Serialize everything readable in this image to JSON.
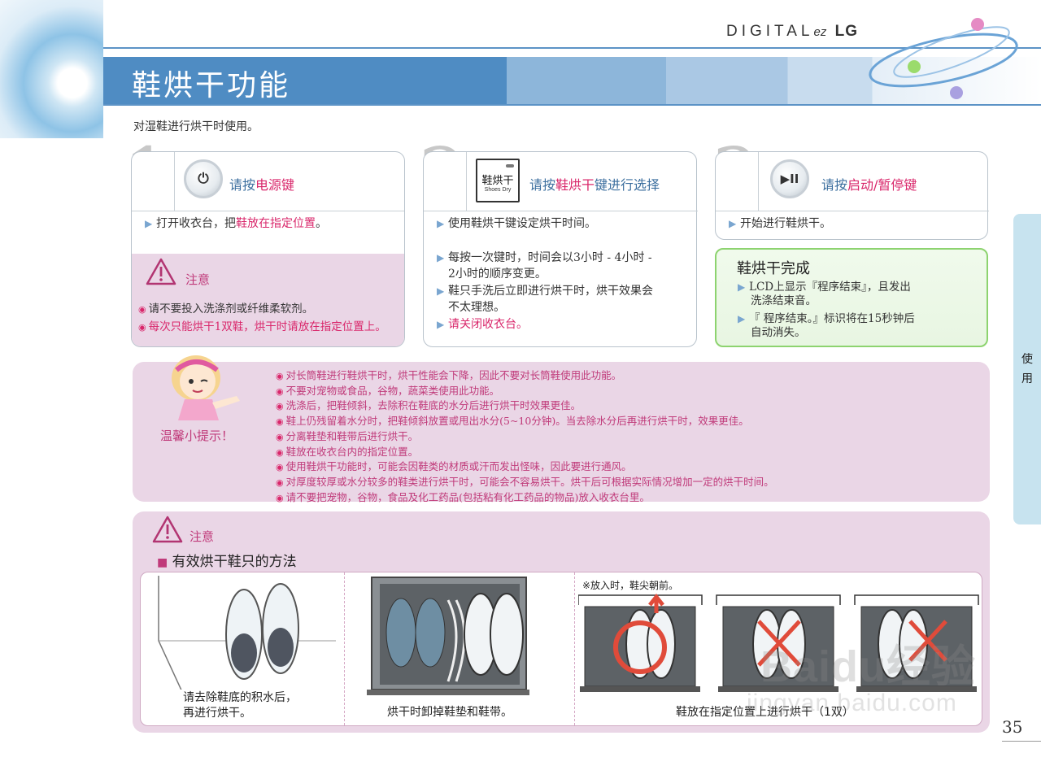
{
  "header": {
    "page_title": "鞋烘干功能",
    "brand_main": "DIGITAL",
    "brand_ez": "ez",
    "brand_lg": "LG"
  },
  "intro": "对湿鞋进行烘干时使用。",
  "step1": {
    "num": "1",
    "btn_glyph": "⏻",
    "head_pre": "请按",
    "head_hl": "电源键",
    "item_pre": "打开收衣台，把",
    "item_hl": "鞋放在指定位置",
    "item_post": "。",
    "caution_title": "注意",
    "caution_items": [
      "请不要投入洗涤剂或纤维柔软剂。",
      "每次只能烘干1双鞋，烘干时请放在指定位置上。"
    ]
  },
  "step2": {
    "num": "2",
    "btn_label_cn": "鞋烘干",
    "btn_label_en": "Shoes Dry",
    "head_pre": "请按",
    "head_hl": "鞋烘干",
    "head_post": "键进行选择",
    "items": [
      "使用鞋烘干键设定烘干时间。",
      "每按一次键时，时间会以3小时 - 4小时 -",
      "2小时的顺序变更。",
      "鞋只手洗后立即进行烘干时，烘干效果会",
      "不太理想。",
      "请关闭收衣台。"
    ]
  },
  "step3": {
    "num": "3",
    "btn_glyph": "▶II",
    "head_pre": "请按",
    "head_hl": "启动/暂停键",
    "item": "开始进行鞋烘干。"
  },
  "done": {
    "title": "鞋烘干完成",
    "items": [
      "LCD上显示『程序结束』，且发出",
      "洗涤结束音。",
      "『 程序结束。』标识将在15秒钟后",
      "自动消失。"
    ]
  },
  "tips": {
    "label": "温馨小提示！",
    "items": [
      "对长筒鞋进行鞋烘干时，烘干性能会下降，因此不要对长筒鞋使用此功能。",
      "不要对宠物或食品，谷物，蔬菜类使用此功能。",
      "洗涤后，把鞋倾斜，去除积在鞋底的水分后进行烘干时效果更佳。",
      "鞋上仍残留着水分时，把鞋倾斜放置或甩出水分(5~10分钟)。当去除水分后再进行烘干时，效果更佳。",
      "分离鞋垫和鞋带后进行烘干。",
      "鞋放在收衣台内的指定位置。",
      "使用鞋烘干功能时，可能会因鞋类的材质或汗而发出怪味，因此要进行通风。",
      "对厚度较厚或水分较多的鞋类进行烘干时，可能会不容易烘干。烘干后可根据实际情况增加一定的烘干时间。",
      "请不要把宠物，谷物，食品及化工药品(包括粘有化工药品的物品)放入收衣台里。"
    ]
  },
  "caution2": {
    "title": "注意",
    "subtitle": "有效烘干鞋只的方法",
    "note": "※放入时，鞋尖朝前。",
    "caption1_line1": "请去除鞋底的积水后，",
    "caption1_line2": "再进行烘干。",
    "caption2": "烘干时卸掉鞋垫和鞋带。",
    "caption3": "鞋放在指定位置上进行烘干（1双）"
  },
  "side_tab": "使用",
  "page_number": "35",
  "watermark": {
    "text": "Baidu经验",
    "url": "jingyan.baidu.com"
  },
  "colors": {
    "accent_blue": "#4f8cc3",
    "highlight_pink": "#d9276b",
    "panel_pink": "#ead6e6",
    "done_green": "#8dd36f"
  }
}
